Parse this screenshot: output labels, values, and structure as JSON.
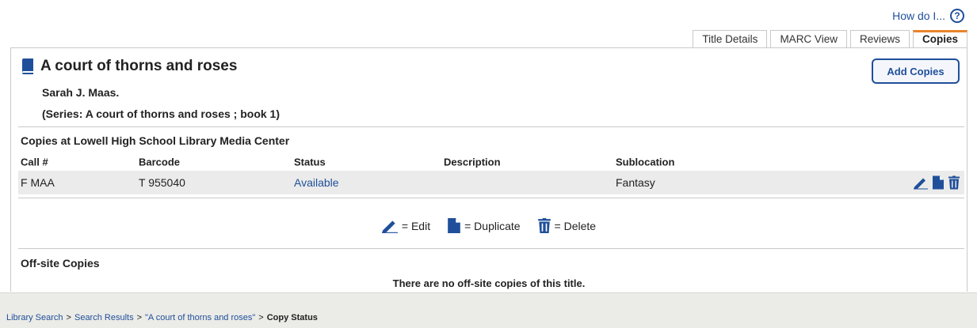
{
  "help": {
    "label": "How do I...",
    "icon": "help-icon"
  },
  "tabs": [
    {
      "label": "Title Details",
      "active": false
    },
    {
      "label": "MARC View",
      "active": false
    },
    {
      "label": "Reviews",
      "active": false
    },
    {
      "label": "Copies",
      "active": true
    }
  ],
  "title": {
    "icon": "book-icon",
    "name": "A court of thorns and roses",
    "author": "Sarah J. Maas.",
    "series": "(Series: A court of thorns and roses ; book 1)"
  },
  "add_copies_label": "Add Copies",
  "copies": {
    "heading": "Copies at Lowell High School Library Media Center",
    "columns": [
      "Call #",
      "Barcode",
      "Status",
      "Description",
      "Sublocation"
    ],
    "rows": [
      {
        "call": "F MAA",
        "barcode": "T 955040",
        "status": "Available",
        "description": "",
        "sublocation": "Fantasy"
      }
    ]
  },
  "legend": {
    "edit": "= Edit",
    "duplicate": "= Duplicate",
    "delete": "= Delete"
  },
  "offsite": {
    "heading": "Off-site Copies",
    "message": "There are no off-site copies of this title."
  },
  "breadcrumb": {
    "items": [
      "Library Search",
      "Search Results",
      "\"A court of thorns and roses\""
    ],
    "separator": ">",
    "current": "Copy Status"
  },
  "colors": {
    "link": "#1f4f9a",
    "active_tab_accent": "#e8842c",
    "row_bg": "#ebebeb",
    "footer_bg": "#ebebe7"
  }
}
